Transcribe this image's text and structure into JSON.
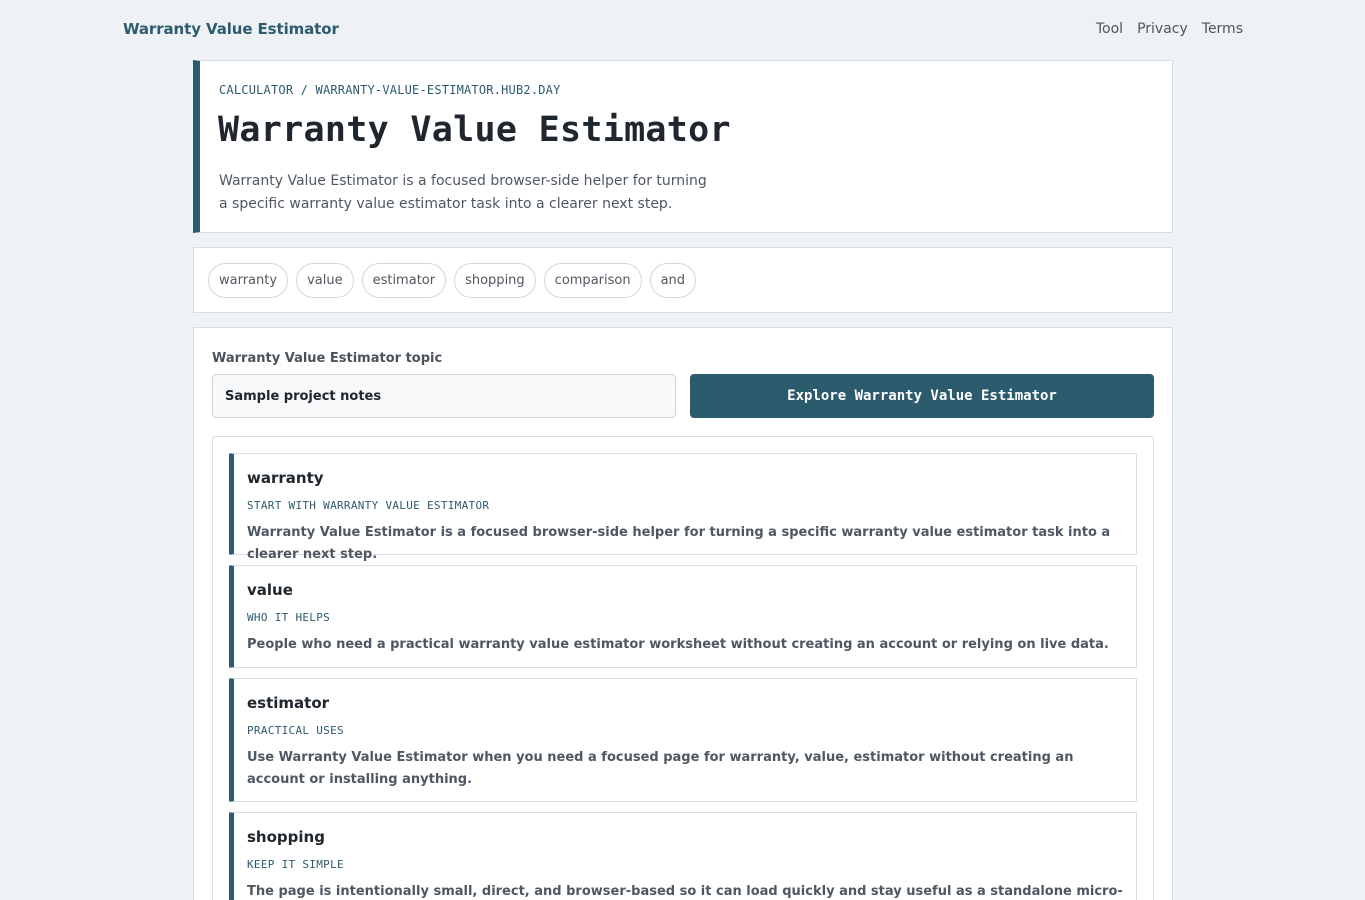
{
  "nav": {
    "brand": "Warranty Value Estimator",
    "links": [
      "Tool",
      "Privacy",
      "Terms"
    ]
  },
  "hero": {
    "breadcrumb": "CALCULATOR / WARRANTY-VALUE-ESTIMATOR.HUB2.DAY",
    "title": "Warranty Value Estimator",
    "description": "Warranty Value Estimator is a focused browser-side helper for turning a specific warranty value estimator task into a clearer next step."
  },
  "tags": [
    "warranty",
    "value",
    "estimator",
    "shopping",
    "comparison",
    "and"
  ],
  "tool": {
    "field_label": "Warranty Value Estimator topic",
    "input_value": "Sample project notes",
    "button_label": "Explore Warranty Value Estimator",
    "results": [
      {
        "title": "warranty",
        "kicker": "START WITH WARRANTY VALUE ESTIMATOR",
        "body": "Warranty Value Estimator is a focused browser-side helper for turning a specific warranty value estimator task into a clearer next step."
      },
      {
        "title": "value",
        "kicker": "WHO IT HELPS",
        "body": "People who need a practical warranty value estimator worksheet without creating an account or relying on live data."
      },
      {
        "title": "estimator",
        "kicker": "PRACTICAL USES",
        "body": "Use Warranty Value Estimator when you need a focused page for warranty, value, estimator without creating an account or installing anything."
      },
      {
        "title": "shopping",
        "kicker": "KEEP IT SIMPLE",
        "body": "The page is intentionally small, direct, and browser-based so it can load quickly and stay useful as a standalone micro-site."
      }
    ]
  },
  "colors": {
    "accent": "#2d5b6e",
    "background": "#eff2f5",
    "card": "#ffffff"
  }
}
